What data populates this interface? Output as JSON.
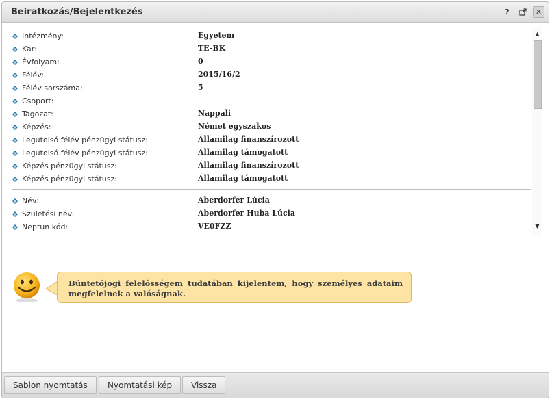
{
  "window": {
    "title": "Beiratkozás/Bejelentkezés"
  },
  "titlebar_icons": {
    "help": "?",
    "popout": "⇱",
    "close": "✕"
  },
  "rows": [
    {
      "label": "Intézmény:",
      "value": "Egyetem"
    },
    {
      "label": "Kar:",
      "value": "TE-BK"
    },
    {
      "label": "Évfolyam:",
      "value": "0"
    },
    {
      "label": "Félév:",
      "value": "2015/16/2"
    },
    {
      "label": "Félév sorszáma:",
      "value": "5"
    },
    {
      "label": "Csoport:",
      "value": ""
    },
    {
      "label": "Tagozat:",
      "value": "Nappali"
    },
    {
      "label": "Képzés:",
      "value": "Német egyszakos"
    },
    {
      "label": "Legutolsó félév pénzügyi státusz:",
      "value": "Államilag finanszírozott"
    },
    {
      "label": "Legutolsó félév pénzügyi státusz:",
      "value": "Államilag támogatott"
    },
    {
      "label": "Képzés pénzügyi státusz:",
      "value": "Államilag finanszírozott"
    },
    {
      "label": "Képzés pénzügyi státusz:",
      "value": "Államilag támogatott"
    }
  ],
  "personal": [
    {
      "label": "Név:",
      "value": "Aberdorfer Lúcia"
    },
    {
      "label": "Születési név:",
      "value": "Aberdorfer Huba Lúcia"
    },
    {
      "label": "Neptun kód:",
      "value": "VE0FZZ"
    }
  ],
  "notice": {
    "text": "Büntetőjogi felelősségem tudatában kijelentem, hogy személyes adataim megfelelnek a valóságnak."
  },
  "footer": {
    "template_print": "Sablon nyomtatás",
    "print_view": "Nyomtatási kép",
    "back": "Vissza"
  },
  "colors": {
    "bullet": "#2a7aa8",
    "bubble_bg": "#fde4a5",
    "bubble_border": "#e1b965",
    "smiley": "#f6b21a"
  },
  "icons": {
    "row_bullet": "diamond-bullet-icon",
    "smiley": "smiley-icon"
  }
}
